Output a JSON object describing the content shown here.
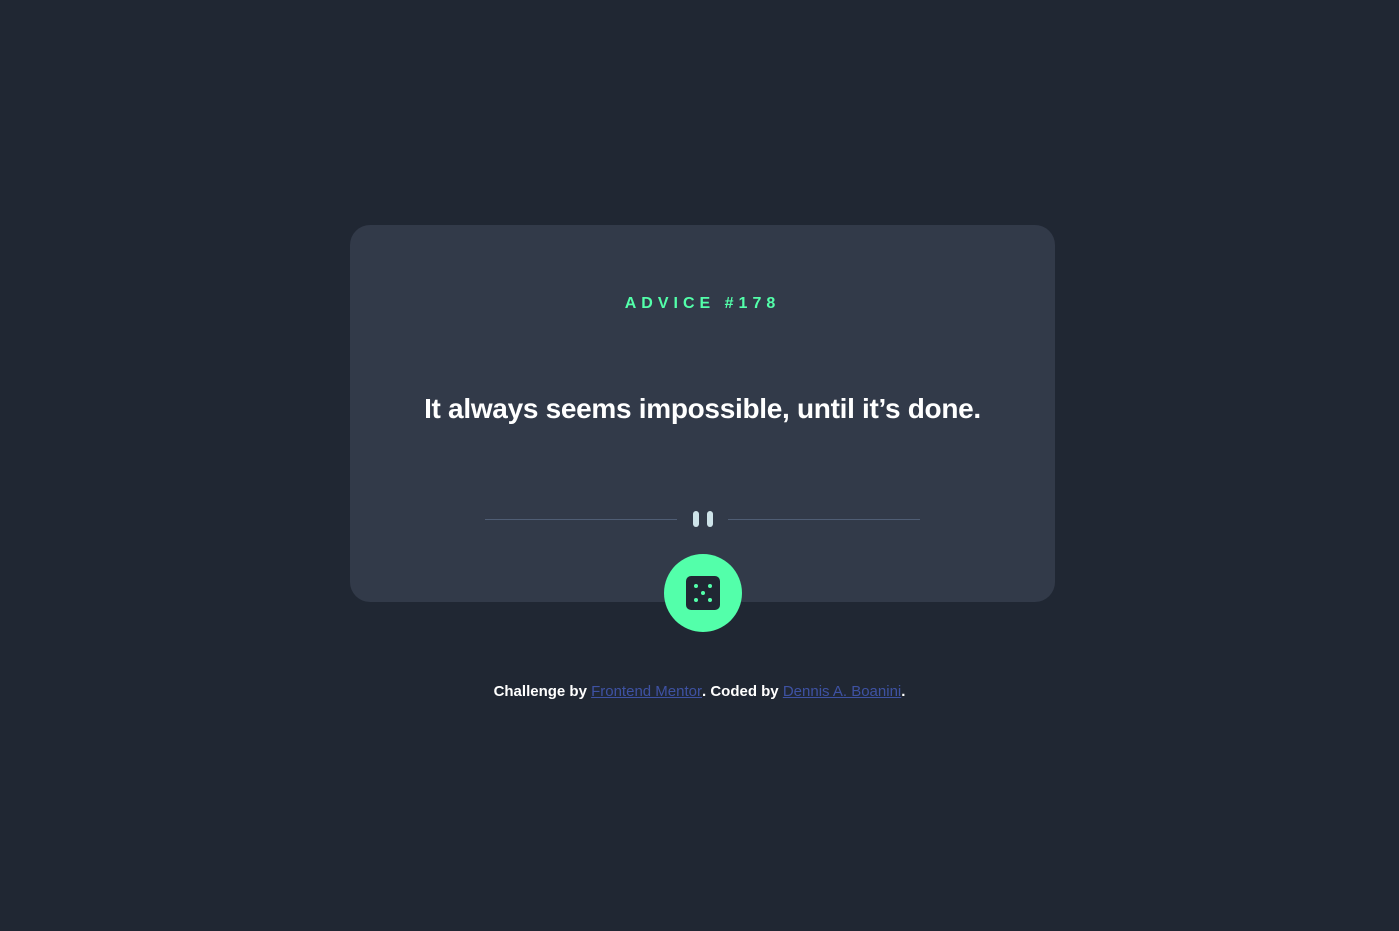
{
  "advice": {
    "id_label": "ADVICE #178",
    "text": "It always seems impossible, until it’s done."
  },
  "button": {
    "icon": "dice-icon",
    "action": "generate-advice"
  },
  "footer": {
    "prefix": "Challenge by ",
    "link1": "Frontend Mentor",
    "middle": ". Coded by ",
    "link2": "Dennis A. Boanini",
    "suffix": "."
  },
  "colors": {
    "background": "#202733",
    "card": "#323a49",
    "accent": "#53ffaa",
    "text": "#ffffff",
    "divider": "#4f5d74",
    "link": "#3e52a3"
  }
}
